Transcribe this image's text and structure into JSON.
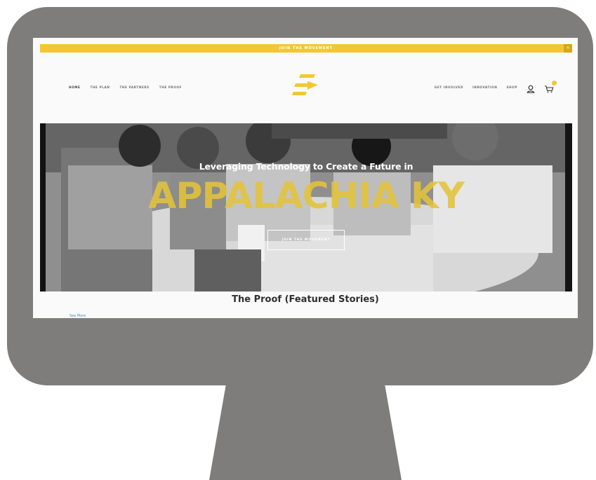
{
  "banner": {
    "text": "JOIN THE MOVEMENT",
    "close": "×"
  },
  "nav_left": [
    "HOME",
    "THE PLAN",
    "THE PARTNERS",
    "THE PROOF"
  ],
  "nav_right": [
    "GET INVOLVED",
    "INNOVATION",
    "SHOP"
  ],
  "icons": {
    "logo": "lightning-bolt-logo",
    "user": "user-icon",
    "cart": "cart-icon"
  },
  "hero": {
    "subtitle": "Leveraging Technology to Create a Future in",
    "title": "APPALACHIA KY",
    "button": "JOIN THE MOVEMENT"
  },
  "section": {
    "title": "The Proof (Featured Stories)",
    "link": "See More"
  },
  "colors": {
    "accent": "#f3c731",
    "monitor": "#7e7d7b",
    "link": "#3f8fb3"
  }
}
